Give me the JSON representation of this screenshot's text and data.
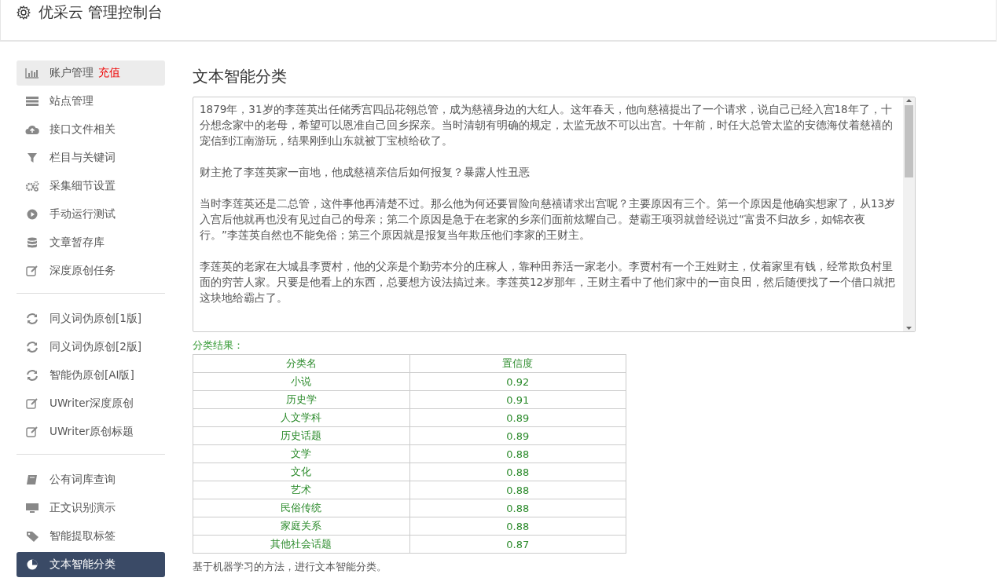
{
  "header": {
    "title": "优采云 管理控制台"
  },
  "sidebar": {
    "groups": [
      [
        {
          "label": "账户管理",
          "badge": "充值",
          "selected": false,
          "hovered": true
        },
        {
          "label": "站点管理",
          "selected": false
        },
        {
          "label": "接口文件相关",
          "selected": false
        },
        {
          "label": "栏目与关键词",
          "selected": false
        },
        {
          "label": "采集细节设置",
          "selected": false
        },
        {
          "label": "手动运行测试",
          "selected": false
        },
        {
          "label": "文章暂存库",
          "selected": false
        },
        {
          "label": "深度原创任务",
          "selected": false
        }
      ],
      [
        {
          "label": "同义词伪原创[1版]",
          "selected": false
        },
        {
          "label": "同义词伪原创[2版]",
          "selected": false
        },
        {
          "label": "智能伪原创[AI版]",
          "selected": false
        },
        {
          "label": "UWriter深度原创",
          "selected": false
        },
        {
          "label": "UWriter原创标题",
          "selected": false
        }
      ],
      [
        {
          "label": "公有词库查询",
          "selected": false
        },
        {
          "label": "正文识别演示",
          "selected": false
        },
        {
          "label": "智能提取标签",
          "selected": false
        },
        {
          "label": "文本智能分类",
          "selected": true
        }
      ]
    ]
  },
  "main": {
    "title": "文本智能分类",
    "text_input": {
      "paragraphs": [
        "1879年，31岁的李莲英出任储秀宫四品花翎总管，成为慈禧身边的大红人。这年春天，他向慈禧提出了一个请求，说自己已经入宫18年了，十分想念家中的老母，希望可以恩准自己回乡探亲。当时清朝有明确的规定，太监无故不可以出宫。十年前，时任大总管太监的安德海仗着慈禧的宠信到江南游玩，结果刚到山东就被丁宝桢给砍了。",
        "财主抢了李莲英家一亩地，他成慈禧亲信后如何报复？暴露人性丑恶",
        "当时李莲英还是二总管，这件事他再清楚不过。那么他为何还要冒险向慈禧请求出宫呢？主要原因有三个。第一个原因是他确实想家了，从13岁入宫后他就再也没有见过自己的母亲；第二个原因是急于在老家的乡亲们面前炫耀自己。楚霸王项羽就曾经说过“富贵不归故乡，如锦衣夜行。”李莲英自然也不能免俗；第三个原因就是报复当年欺压他们李家的王财主。",
        "李莲英的老家在大城县李贾村，他的父亲是个勤劳本分的庄稼人，靠种田养活一家老小。李贾村有一个王姓财主，仗着家里有钱，经常欺负村里面的穷苦人家。只要是他看上的东西，总要想方设法搞过来。李莲英12岁那年，王财主看中了他们家中的一亩良田，然后随便找了一个借口就把这块地给霸占了。"
      ]
    },
    "result_label": "分类结果：",
    "table": {
      "columns": [
        "分类名",
        "置信度"
      ],
      "rows": [
        [
          "小说",
          "0.92"
        ],
        [
          "历史学",
          "0.91"
        ],
        [
          "人文学科",
          "0.89"
        ],
        [
          "历史话题",
          "0.89"
        ],
        [
          "文学",
          "0.88"
        ],
        [
          "文化",
          "0.88"
        ],
        [
          "艺术",
          "0.88"
        ],
        [
          "民俗传统",
          "0.88"
        ],
        [
          "家庭关系",
          "0.88"
        ],
        [
          "其他社会话题",
          "0.87"
        ]
      ]
    },
    "footnote": "基于机器学习的方法，进行文本智能分类。"
  }
}
